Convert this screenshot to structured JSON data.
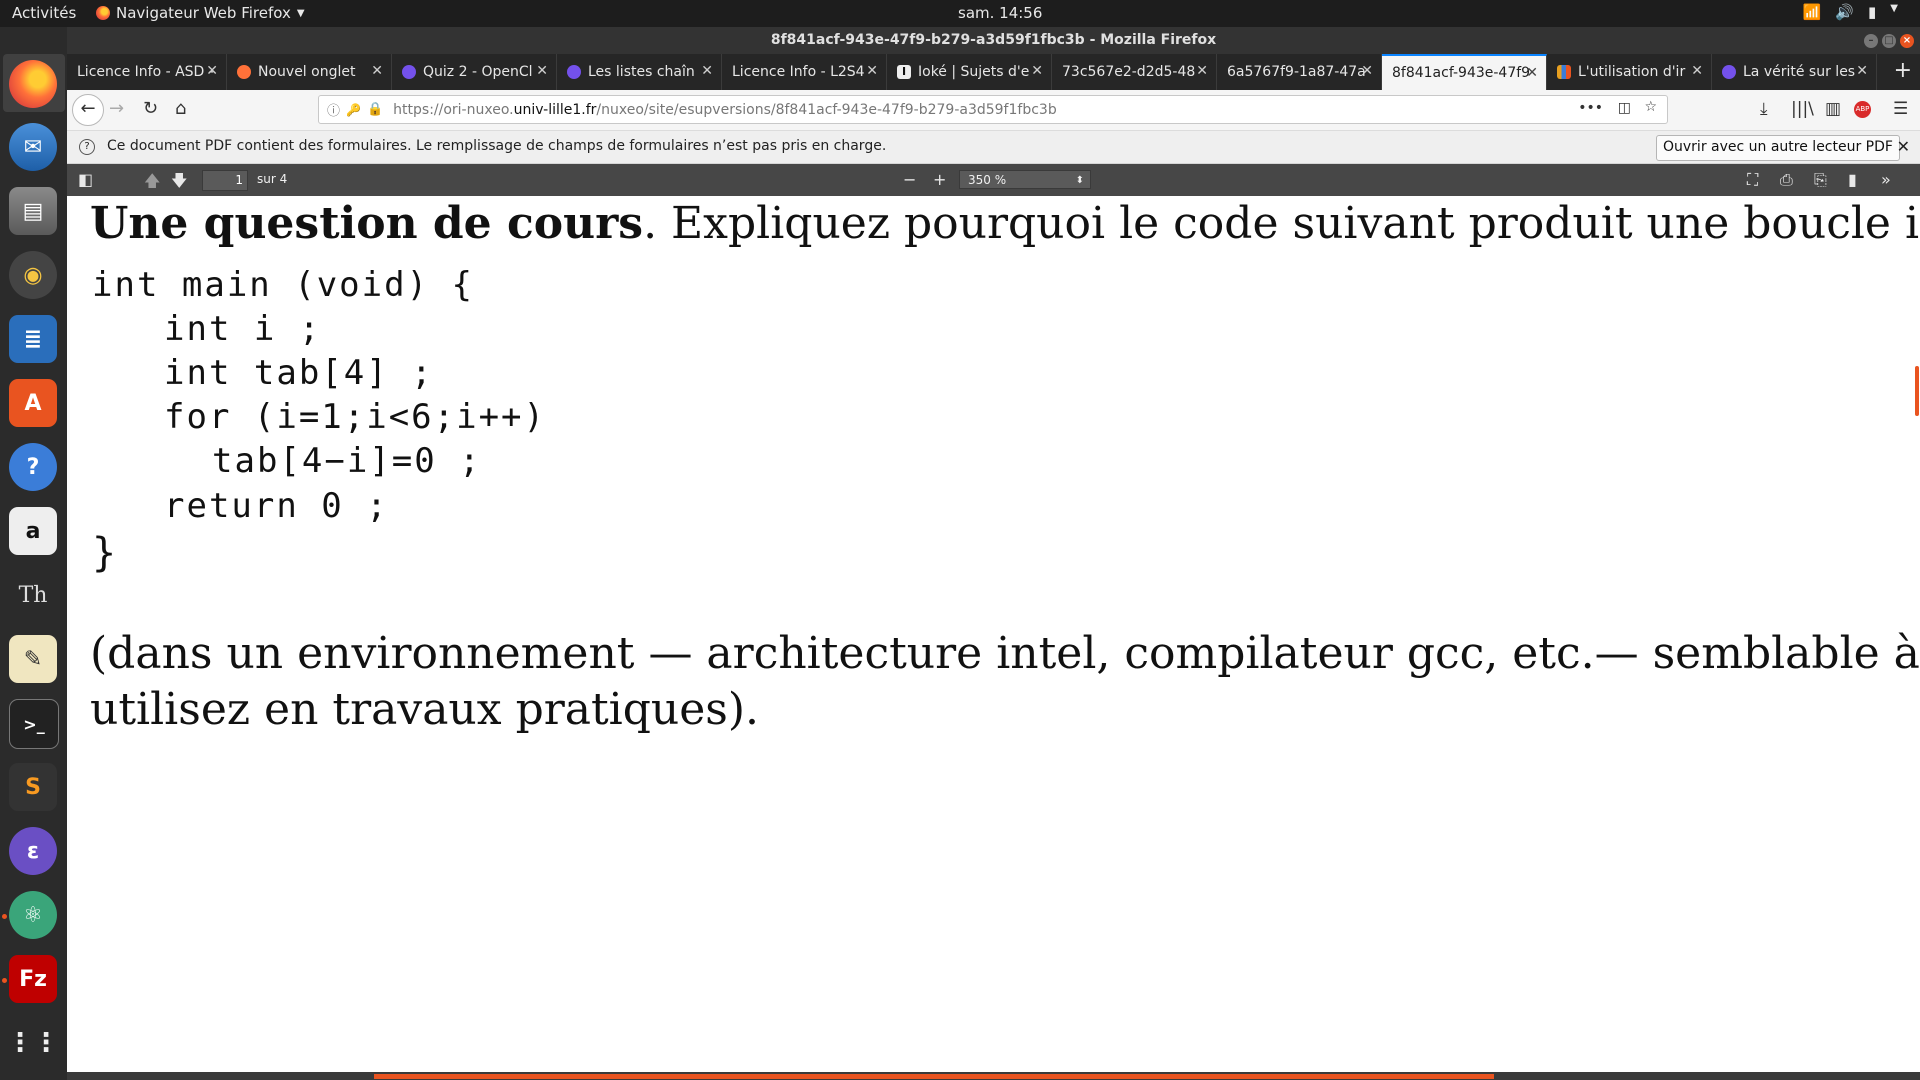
{
  "topbar": {
    "activities": "Activités",
    "app_menu": "Navigateur Web Firefox",
    "clock": "sam. 14:56"
  },
  "window": {
    "title": "8f841acf-943e-47f9-b279-a3d59f1fbc3b - Mozilla Firefox"
  },
  "tabs": [
    {
      "label": "Licence Info - ASD -",
      "favicon": "none",
      "color": ""
    },
    {
      "label": "Nouvel onglet",
      "favicon": "firefox-icon",
      "color": "#ff7139"
    },
    {
      "label": "Quiz 2 - OpenCl",
      "favicon": "openclassrooms-icon",
      "color": "#7451eb"
    },
    {
      "label": "Les listes chaîn",
      "favicon": "openclassrooms-icon",
      "color": "#7451eb"
    },
    {
      "label": "Licence Info - L2S4",
      "favicon": "none",
      "color": ""
    },
    {
      "label": "Ioké | Sujets d'e",
      "favicon": "ioke-icon",
      "color": "#111111"
    },
    {
      "label": "73c567e2-d2d5-48",
      "favicon": "none",
      "color": ""
    },
    {
      "label": "6a5767f9-1a87-47a",
      "favicon": "none",
      "color": ""
    },
    {
      "label": "8f841acf-943e-47f9",
      "favicon": "none",
      "color": "",
      "active": true
    },
    {
      "label": "L'utilisation d'ir",
      "favicon": "chart-icon",
      "color": "#e8a020"
    },
    {
      "label": "La vérité sur les",
      "favicon": "openclassrooms-icon",
      "color": "#7451eb"
    }
  ],
  "navbar": {
    "url_prefix": "https://ori-nuxeo.",
    "url_domain": "univ-lille1.fr",
    "url_path": "/nuxeo/site/esupversions/8f841acf-943e-47f9-b279-a3d59f1fbc3b"
  },
  "notification": {
    "message": "Ce document PDF contient des formulaires. Le remplissage de champs de formulaires n’est pas pris en charge.",
    "button": "Ouvrir avec un autre lecteur PDF"
  },
  "pdf_toolbar": {
    "page_number": "1",
    "page_count": "sur 4",
    "zoom": "350 %"
  },
  "document": {
    "heading_bold": "Une question de cours",
    "heading_rest": ". Expliquez pourquoi le code suivant produit une boucle infinie",
    "code_lines": [
      "int main (void) {",
      "int i ;",
      "int tab[4] ;",
      "for (i=1;i<6;i++)",
      "tab[4−i]=0 ;",
      "return 0 ;",
      "}"
    ],
    "paragraph_line1": "(dans un environnement — architecture intel, compilateur gcc, etc.— semblable à cel",
    "paragraph_line2": "utilisez en travaux pratiques)."
  },
  "colors": {
    "accent": "#e95420",
    "tab_active_border": "#0a84ff"
  }
}
